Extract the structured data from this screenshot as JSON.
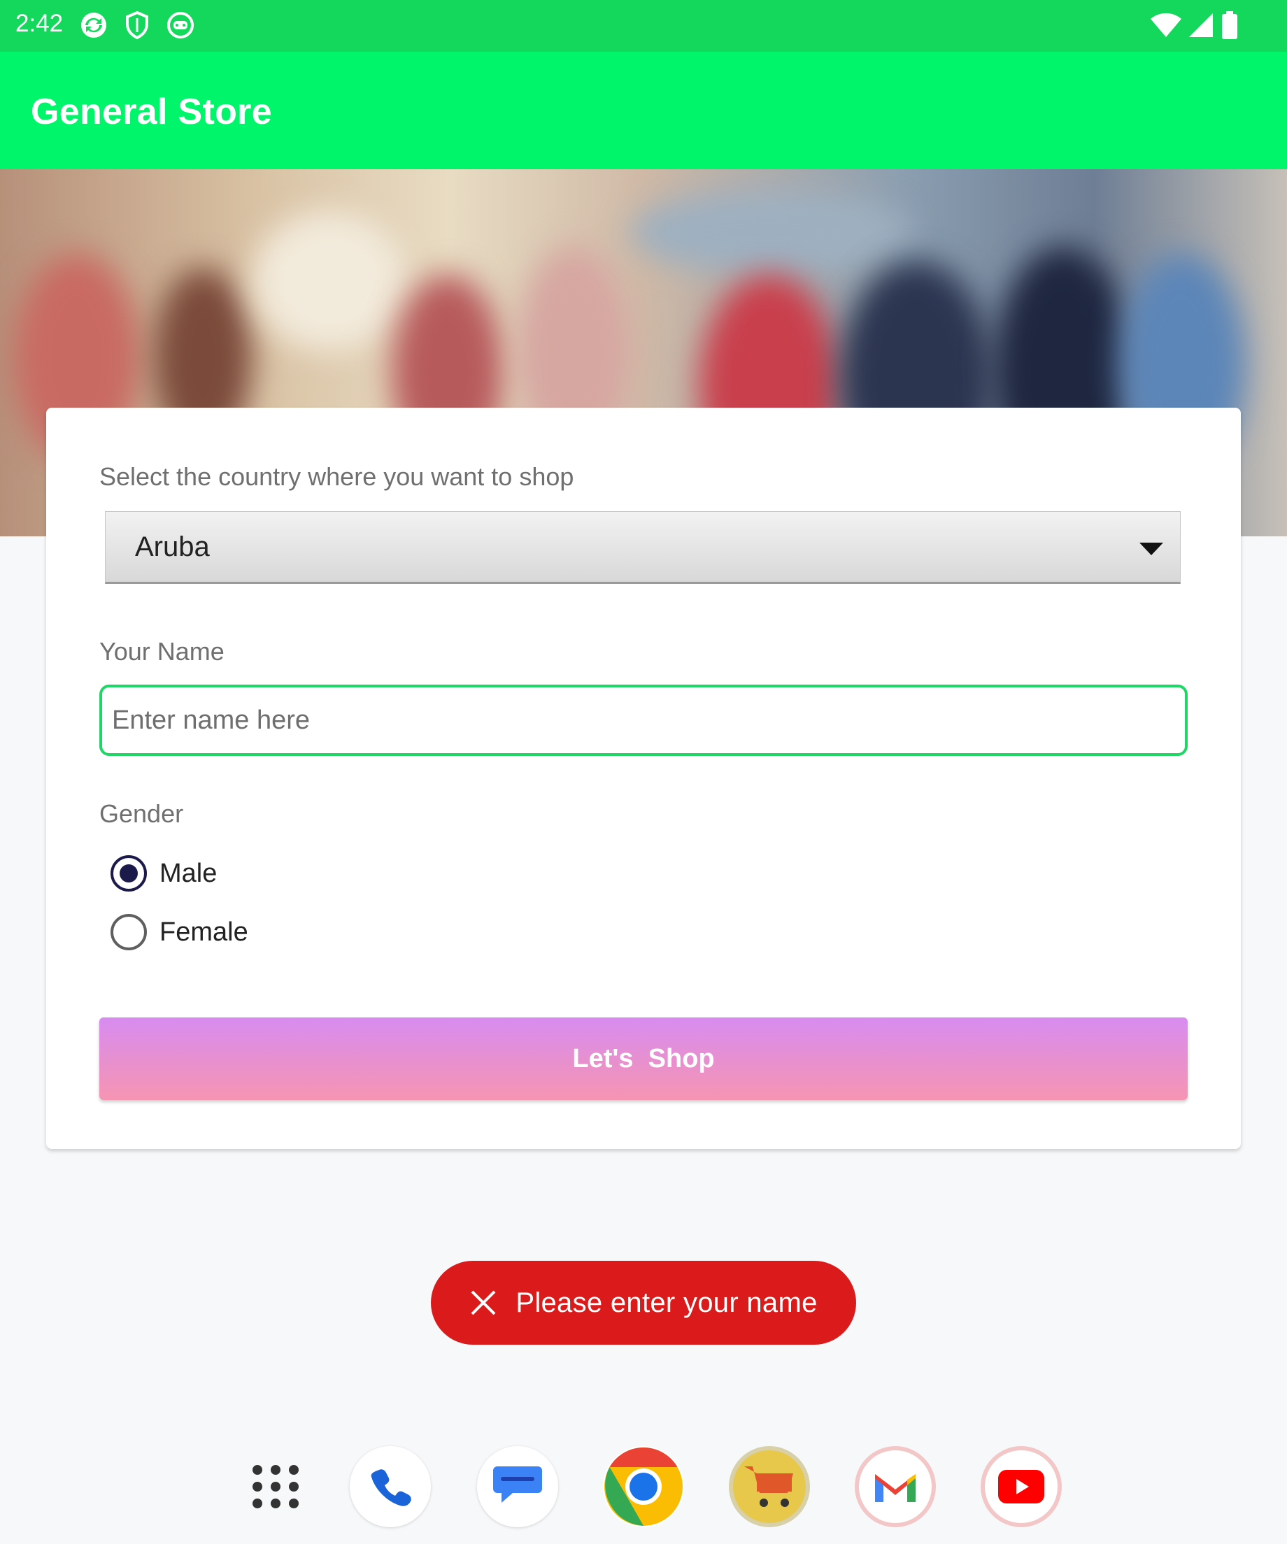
{
  "status_bar": {
    "time": "2:42"
  },
  "app_bar": {
    "title": "General Store"
  },
  "form": {
    "country_label": "Select the country where you want to shop",
    "country_selected": "Aruba",
    "name_label": "Your Name",
    "name_value": "",
    "name_placeholder": "Enter name here",
    "gender_label": "Gender",
    "gender_options": [
      {
        "label": "Male",
        "checked": true
      },
      {
        "label": "Female",
        "checked": false
      }
    ],
    "submit_label": "Let's  Shop"
  },
  "toast": {
    "message": "Please enter your name"
  },
  "colors": {
    "status_bar": "#14d85c",
    "app_bar": "#00f56a",
    "input_focus": "#1ed764",
    "button_gradient_top": "#d78cf0",
    "button_gradient_bottom": "#f694b2",
    "toast": "#db1b1b"
  },
  "dock": {
    "apps": [
      "app-drawer-icon",
      "phone-icon",
      "messages-icon",
      "chrome-icon",
      "shopping-cart-icon",
      "gmail-icon",
      "youtube-icon"
    ]
  }
}
